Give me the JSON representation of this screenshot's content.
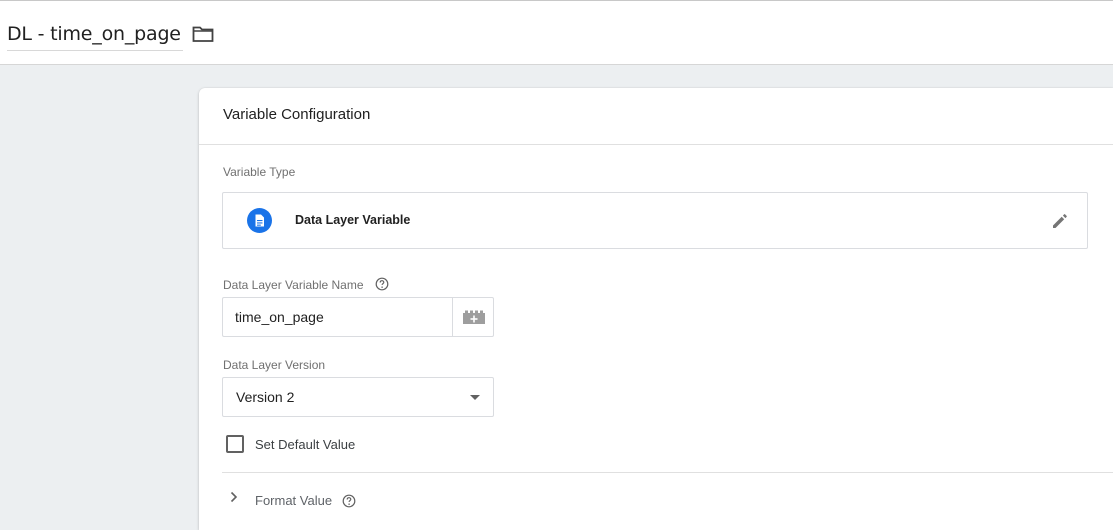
{
  "header": {
    "title": "DL - time_on_page",
    "folder_icon": "folder-outline-icon"
  },
  "card": {
    "title": "Variable Configuration",
    "variable_type": {
      "label": "Variable Type",
      "name": "Data Layer Variable",
      "icon": "document-icon",
      "icon_color": "#1a73e8",
      "edit_icon": "pencil-icon"
    },
    "name_field": {
      "label": "Data Layer Variable Name",
      "value": "time_on_page",
      "help_icon": "help-icon",
      "picker_icon": "variable-picker-icon"
    },
    "version_field": {
      "label": "Data Layer Version",
      "value": "Version 2"
    },
    "default_value": {
      "label": "Set Default Value",
      "checked": false
    },
    "format_value": {
      "label": "Format Value",
      "help_icon": "help-icon"
    }
  }
}
